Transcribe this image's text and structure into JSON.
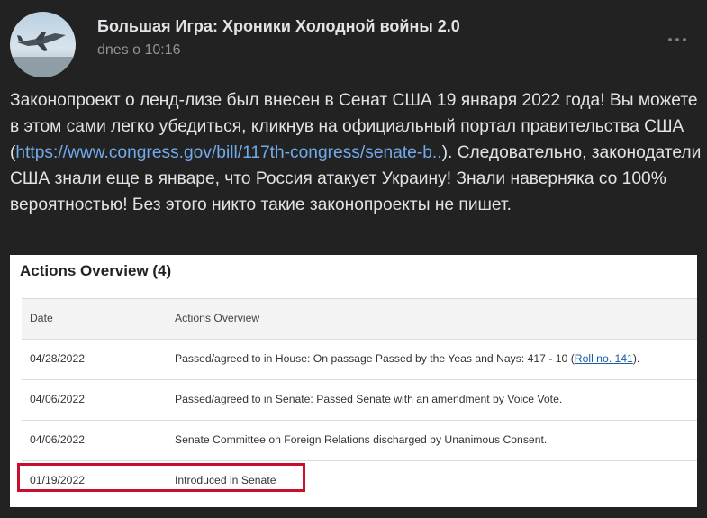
{
  "post": {
    "channel_name": "Большая Игра: Хроники Холодной войны 2.0",
    "time": "dnes o 10:16",
    "text_before_link": "Законопроект о ленд-лизе был внесен в Сенат США 19 января 2022 года! Вы можете в этом сами легко убедиться, кликнув на официальный портал правительства США (",
    "link_text": "https://www.congress.gov/bill/117th-congress/senate-b..",
    "text_after_link": "). Следовательно, законодатели США знали еще в январе, что Россия атакует Украину! Знали наверняка со 100% вероятностью! Без этого никто такие законопроекты не пишет.",
    "avatar_icon": "fighter-jet-icon",
    "more_icon": "more-dots-icon"
  },
  "screenshot": {
    "title": "Actions Overview (4)",
    "header": {
      "date": "Date",
      "actions": "Actions Overview"
    },
    "rows": [
      {
        "date": "04/28/2022",
        "action": "Passed/agreed to in House: On passage Passed by the Yeas and Nays: 417 - 10 (",
        "link": "Roll no. 141",
        "after_link": ")."
      },
      {
        "date": "04/06/2022",
        "action": "Passed/agreed to in Senate: Passed Senate with an amendment by Voice Vote."
      },
      {
        "date": "04/06/2022",
        "action": "Senate Committee on Foreign Relations discharged by Unanimous Consent."
      },
      {
        "date": "01/19/2022",
        "action": "Introduced in Senate"
      }
    ],
    "highlight_color": "#c8102e"
  }
}
